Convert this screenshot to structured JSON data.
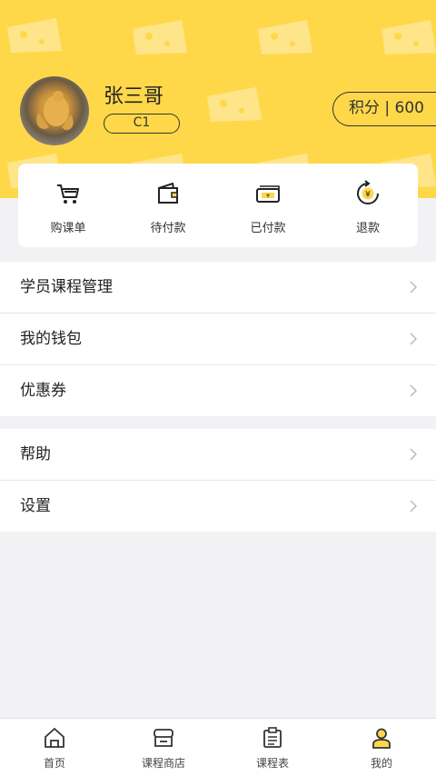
{
  "colors": {
    "accent": "#ffd84a",
    "background": "#f2f2f4",
    "card": "#ffffff"
  },
  "profile": {
    "name": "张三哥",
    "level": "C1",
    "points": "积分 | 600"
  },
  "orders": [
    {
      "label": "购课单",
      "icon": "shopping-cart-icon"
    },
    {
      "label": "待付款",
      "icon": "wallet-icon"
    },
    {
      "label": "已付款",
      "icon": "cash-icon"
    },
    {
      "label": "退款",
      "icon": "refund-icon"
    }
  ],
  "menu1": [
    {
      "label": "学员课程管理"
    },
    {
      "label": "我的钱包"
    },
    {
      "label": "优惠券"
    }
  ],
  "menu2": [
    {
      "label": "帮助"
    },
    {
      "label": "设置"
    }
  ],
  "tabbar": [
    {
      "label": "首页",
      "icon": "home-icon"
    },
    {
      "label": "课程商店",
      "icon": "store-icon"
    },
    {
      "label": "课程表",
      "icon": "schedule-icon"
    },
    {
      "label": "我的",
      "icon": "user-icon",
      "active": true
    }
  ]
}
